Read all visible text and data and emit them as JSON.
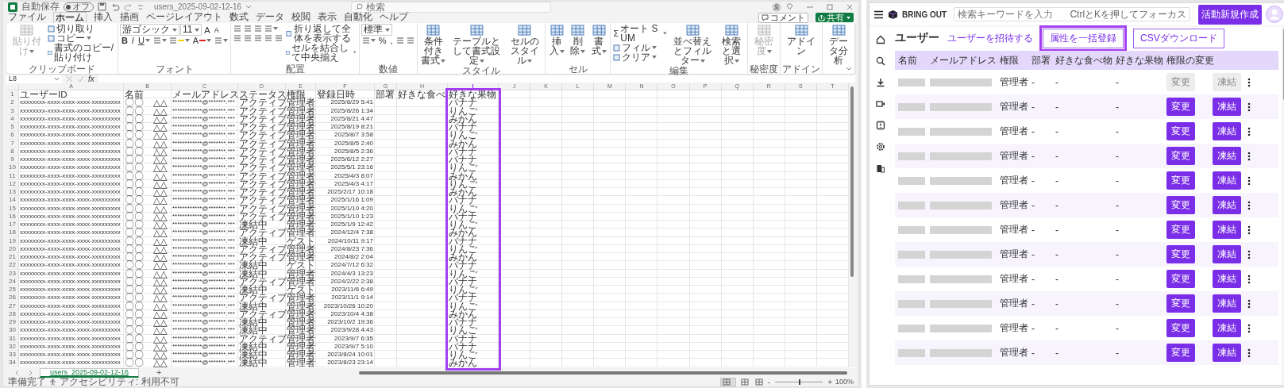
{
  "excel": {
    "title_bar": {
      "autosave_label": "自動保存",
      "autosave_toggle": {
        "label": "オフ",
        "on": false
      },
      "file_name": "users_2025-09-02-12-16",
      "search_placeholder": "検索"
    },
    "menu_tabs": [
      {
        "label": "ファイル",
        "selected": false
      },
      {
        "label": "ホーム",
        "selected": true
      },
      {
        "label": "挿入",
        "selected": false
      },
      {
        "label": "描画",
        "selected": false
      },
      {
        "label": "ページレイアウト",
        "selected": false
      },
      {
        "label": "数式",
        "selected": false
      },
      {
        "label": "データ",
        "selected": false
      },
      {
        "label": "校閲",
        "selected": false
      },
      {
        "label": "表示",
        "selected": false
      },
      {
        "label": "自動化",
        "selected": false
      },
      {
        "label": "ヘルプ",
        "selected": false
      }
    ],
    "comment_button": "コメント",
    "share_button": "共有",
    "ribbon": {
      "groups": [
        {
          "label": "クリップボード",
          "parts": [
            {
              "kind": "big",
              "label": "貼り付け",
              "disabled": true,
              "caret": true
            },
            {
              "kind": "stack",
              "lines": [
                {
                  "items": [
                    {
                      "kind": "small",
                      "label": "切り取り",
                      "caret": false
                    }
                  ]
                },
                {
                  "items": [
                    {
                      "kind": "small",
                      "label": "コピー",
                      "caret": true
                    }
                  ]
                },
                {
                  "items": [
                    {
                      "kind": "small",
                      "label": "書式のコピー/貼り付け",
                      "caret": false
                    }
                  ]
                }
              ]
            }
          ]
        },
        {
          "label": "フォント",
          "parts": [
            {
              "kind": "stack",
              "lines": [
                {
                  "items": [
                    {
                      "kind": "select",
                      "value": "游ゴシック"
                    },
                    {
                      "kind": "select",
                      "value": "11"
                    },
                    {
                      "kind": "glyph",
                      "text": "A",
                      "caret": false
                    },
                    {
                      "kind": "glyph",
                      "text": "A",
                      "caret": false
                    }
                  ]
                },
                {
                  "items": [
                    {
                      "kind": "glyph",
                      "text": "B",
                      "caret": false
                    },
                    {
                      "kind": "glyph",
                      "text": "I",
                      "caret": false
                    },
                    {
                      "kind": "glyph",
                      "text": "U",
                      "caret": true
                    },
                    {
                      "kind": "icon",
                      "caret": true
                    },
                    {
                      "kind": "icon",
                      "color": "#f2d600",
                      "caret": true
                    },
                    {
                      "kind": "glyph",
                      "text": "A",
                      "color": "#e02020",
                      "caret": true
                    },
                    {
                      "kind": "icon",
                      "caret": true
                    }
                  ]
                }
              ]
            }
          ]
        },
        {
          "label": "配置",
          "parts": [
            {
              "kind": "stack",
              "lines": [
                {
                  "items": [
                    {
                      "kind": "icon",
                      "caret": false
                    },
                    {
                      "kind": "icon",
                      "caret": false
                    },
                    {
                      "kind": "icon",
                      "caret": false
                    },
                    {
                      "kind": "icon",
                      "caret": true
                    }
                  ]
                },
                {
                  "items": [
                    {
                      "kind": "icon",
                      "caret": false
                    },
                    {
                      "kind": "icon",
                      "caret": false
                    },
                    {
                      "kind": "icon",
                      "caret": false
                    },
                    {
                      "kind": "icon",
                      "caret": false
                    },
                    {
                      "kind": "icon",
                      "caret": false
                    }
                  ]
                }
              ]
            },
            {
              "kind": "stack",
              "lines": [
                {
                  "items": [
                    {
                      "kind": "small",
                      "label": "折り返して全体を表示する",
                      "caret": false
                    }
                  ]
                },
                {
                  "items": [
                    {
                      "kind": "small",
                      "label": "セルを結合して中央揃え",
                      "caret": true
                    }
                  ]
                }
              ]
            }
          ]
        },
        {
          "label": "数値",
          "parts": [
            {
              "kind": "stack",
              "lines": [
                {
                  "items": [
                    {
                      "kind": "select",
                      "value": "標準"
                    }
                  ]
                },
                {
                  "items": [
                    {
                      "kind": "icon",
                      "caret": true
                    },
                    {
                      "kind": "glyph",
                      "text": "%",
                      "caret": false
                    },
                    {
                      "kind": "glyph",
                      "text": ",",
                      "caret": false
                    },
                    {
                      "kind": "icon",
                      "caret": false
                    },
                    {
                      "kind": "icon",
                      "caret": false
                    }
                  ]
                }
              ]
            }
          ]
        },
        {
          "label": "スタイル",
          "parts": [
            {
              "kind": "big",
              "label": "条件付き書式",
              "disabled": false,
              "caret": true
            },
            {
              "kind": "big",
              "label": "テーブルとして書式設定",
              "disabled": false,
              "caret": true
            },
            {
              "kind": "big",
              "label": "セルのスタイル",
              "disabled": false,
              "caret": true
            }
          ]
        },
        {
          "label": "セル",
          "parts": [
            {
              "kind": "big",
              "label": "挿入",
              "disabled": false,
              "caret": true
            },
            {
              "kind": "big",
              "label": "削除",
              "disabled": false,
              "caret": true
            },
            {
              "kind": "big",
              "label": "書式",
              "disabled": false,
              "caret": true
            }
          ]
        },
        {
          "label": "編集",
          "parts": [
            {
              "kind": "stack",
              "lines": [
                {
                  "items": [
                    {
                      "kind": "small",
                      "glyph": "Σ",
                      "label": "オート SUM",
                      "caret": true
                    }
                  ]
                },
                {
                  "items": [
                    {
                      "kind": "small",
                      "label": "フィル",
                      "caret": true
                    }
                  ]
                },
                {
                  "items": [
                    {
                      "kind": "small",
                      "label": "クリア",
                      "caret": true
                    }
                  ]
                }
              ]
            },
            {
              "kind": "big",
              "label": "並べ替えとフィルター",
              "disabled": false,
              "caret": true
            },
            {
              "kind": "big",
              "label": "検索と選択",
              "disabled": false,
              "caret": true
            }
          ]
        },
        {
          "label": "秘密度",
          "parts": [
            {
              "kind": "big",
              "label": "秘密度",
              "disabled": true,
              "caret": true
            }
          ]
        },
        {
          "label": "アドイン",
          "parts": [
            {
              "kind": "big",
              "label": "アドイン",
              "disabled": false,
              "caret": false
            }
          ]
        },
        {
          "parts": [
            {
              "kind": "big",
              "label": "データ分析",
              "disabled": false,
              "caret": false
            }
          ]
        }
      ]
    },
    "formula_bar": {
      "name_box": "L8",
      "fx": "fx"
    },
    "columns": [
      {
        "letter": "A",
        "highlighted": false
      },
      {
        "letter": "B",
        "highlighted": false
      },
      {
        "letter": "C",
        "highlighted": false
      },
      {
        "letter": "D",
        "highlighted": false
      },
      {
        "letter": "E",
        "highlighted": false
      },
      {
        "letter": "F",
        "highlighted": false
      },
      {
        "letter": "G",
        "highlighted": false
      },
      {
        "letter": "H",
        "highlighted": false
      },
      {
        "letter": "I",
        "highlighted": true
      },
      {
        "letter": "J",
        "highlighted": false
      },
      {
        "letter": "K",
        "highlighted": false
      },
      {
        "letter": "L",
        "highlighted": false
      },
      {
        "letter": "M",
        "highlighted": false
      },
      {
        "letter": "N",
        "highlighted": false
      },
      {
        "letter": "O",
        "highlighted": false
      },
      {
        "letter": "P",
        "highlighted": false
      },
      {
        "letter": "Q",
        "highlighted": false
      },
      {
        "letter": "R",
        "highlighted": false
      },
      {
        "letter": "S",
        "highlighted": false
      },
      {
        "letter": "T",
        "highlighted": false
      }
    ],
    "header_row": {
      "n": "1",
      "cells": [
        "ユーザーID",
        "名前",
        "メールアドレス",
        "ステータス",
        "権限",
        "登録日時",
        "部署",
        "好きな食べ",
        "好きな果物"
      ]
    },
    "rows": [
      {
        "n": "2",
        "id": "xxxxxxxx-xxxx-xxxx-xxxx-xxxxxxxxx",
        "name": "〇〇　△△",
        "email": "************@*******.***",
        "status": "アクティブ",
        "role": "管理者",
        "registered": "2025/8/29 5:41",
        "fruit": "バナナ"
      },
      {
        "n": "3",
        "id": "xxxxxxxx-xxxx-xxxx-xxxx-xxxxxxxxx",
        "name": "〇〇　△△",
        "email": "************@*******.***",
        "status": "アクティブ",
        "role": "管理者",
        "registered": "2025/8/26 1:34",
        "fruit": "りんご"
      },
      {
        "n": "4",
        "id": "xxxxxxxx-xxxx-xxxx-xxxx-xxxxxxxxx",
        "name": "〇〇　△△",
        "email": "************@*******.***",
        "status": "アクティブ",
        "role": "管理者",
        "registered": "2025/8/21 4:47",
        "fruit": "みかん"
      },
      {
        "n": "5",
        "id": "xxxxxxxx-xxxx-xxxx-xxxx-xxxxxxxxx",
        "name": "〇〇　△△",
        "email": "************@*******.***",
        "status": "アクティブ",
        "role": "管理者",
        "registered": "2025/8/19 8:21",
        "fruit": "バナナ"
      },
      {
        "n": "6",
        "id": "xxxxxxxx-xxxx-xxxx-xxxx-xxxxxxxxx",
        "name": "〇〇　△△",
        "email": "************@*******.***",
        "status": "アクティブ",
        "role": "管理者",
        "registered": "2025/8/7 3:58",
        "fruit": "りんご"
      },
      {
        "n": "7",
        "id": "xxxxxxxx-xxxx-xxxx-xxxx-xxxxxxxxx",
        "name": "〇〇　△△",
        "email": "************@*******.***",
        "status": "アクティブ",
        "role": "管理者",
        "registered": "2025/8/5 2:40",
        "fruit": "みかん"
      },
      {
        "n": "8",
        "id": "xxxxxxxx-xxxx-xxxx-xxxx-xxxxxxxxx",
        "name": "〇〇　△△",
        "email": "************@*******.***",
        "status": "アクティブ",
        "role": "管理者",
        "registered": "2025/8/5 2:36",
        "fruit": "バナナ"
      },
      {
        "n": "9",
        "id": "xxxxxxxx-xxxx-xxxx-xxxx-xxxxxxxxx",
        "name": "〇〇　△△",
        "email": "************@*******.***",
        "status": "アクティブ",
        "role": "管理者",
        "registered": "2025/6/12 2:27",
        "fruit": "バナナ"
      },
      {
        "n": "10",
        "id": "xxxxxxxx-xxxx-xxxx-xxxx-xxxxxxxxx",
        "name": "〇〇　△△",
        "email": "************@*******.***",
        "status": "アクティブ",
        "role": "管理者",
        "registered": "2025/5/1 23:16",
        "fruit": "りんご"
      },
      {
        "n": "11",
        "id": "xxxxxxxx-xxxx-xxxx-xxxx-xxxxxxxxx",
        "name": "〇〇　△△",
        "email": "************@*******.***",
        "status": "アクティブ",
        "role": "管理者",
        "registered": "2025/4/3 8:07",
        "fruit": "みかん"
      },
      {
        "n": "12",
        "id": "xxxxxxxx-xxxx-xxxx-xxxx-xxxxxxxxx",
        "name": "〇〇　△△",
        "email": "************@*******.***",
        "status": "アクティブ",
        "role": "管理者",
        "registered": "2025/4/3 4:17",
        "fruit": "りんご"
      },
      {
        "n": "13",
        "id": "xxxxxxxx-xxxx-xxxx-xxxx-xxxxxxxxx",
        "name": "〇〇　△△",
        "email": "************@*******.***",
        "status": "アクティブ",
        "role": "管理者",
        "registered": "2025/2/17 10:18",
        "fruit": "みかん"
      },
      {
        "n": "14",
        "id": "xxxxxxxx-xxxx-xxxx-xxxx-xxxxxxxxx",
        "name": "〇〇　△△",
        "email": "************@*******.***",
        "status": "アクティブ",
        "role": "管理者",
        "registered": "2025/1/16 1:09",
        "fruit": "バナナ"
      },
      {
        "n": "15",
        "id": "xxxxxxxx-xxxx-xxxx-xxxx-xxxxxxxxx",
        "name": "〇〇　△△",
        "email": "************@*******.***",
        "status": "アクティブ",
        "role": "管理者",
        "registered": "2025/1/10 4:20",
        "fruit": "りんご"
      },
      {
        "n": "16",
        "id": "xxxxxxxx-xxxx-xxxx-xxxx-xxxxxxxxx",
        "name": "〇〇　△△",
        "email": "************@*******.***",
        "status": "アクティブ",
        "role": "管理者",
        "registered": "2025/1/10 1:23",
        "fruit": "バナナ"
      },
      {
        "n": "17",
        "id": "xxxxxxxx-xxxx-xxxx-xxxx-xxxxxxxxx",
        "name": "〇〇　△△",
        "email": "************@*******.***",
        "status": "凍結中",
        "role": "管理者",
        "registered": "2025/1/9 12:42",
        "fruit": "りんご"
      },
      {
        "n": "18",
        "id": "xxxxxxxx-xxxx-xxxx-xxxx-xxxxxxxxx",
        "name": "〇〇　△△",
        "email": "************@*******.***",
        "status": "アクティブ",
        "role": "管理者",
        "registered": "2024/12/4 7:38",
        "fruit": "みかん"
      },
      {
        "n": "19",
        "id": "xxxxxxxx-xxxx-xxxx-xxxx-xxxxxxxxx",
        "name": "〇〇　△△",
        "email": "************@*******.***",
        "status": "凍結中",
        "role": "ゲスト",
        "registered": "2024/10/11 9:17",
        "fruit": "バナナ"
      },
      {
        "n": "20",
        "id": "xxxxxxxx-xxxx-xxxx-xxxx-xxxxxxxxx",
        "name": "〇〇　△△",
        "email": "************@*******.***",
        "status": "アクティブ",
        "role": "管理者",
        "registered": "2024/8/23 7:36",
        "fruit": "りんご"
      },
      {
        "n": "21",
        "id": "xxxxxxxx-xxxx-xxxx-xxxx-xxxxxxxxx",
        "name": "〇〇　△△",
        "email": "************@*******.***",
        "status": "アクティブ",
        "role": "管理者",
        "registered": "2024/8/2 2:04",
        "fruit": "みかん"
      },
      {
        "n": "22",
        "id": "xxxxxxxx-xxxx-xxxx-xxxx-xxxxxxxxx",
        "name": "〇〇　△△",
        "email": "************@*******.***",
        "status": "凍結中",
        "role": "ゲスト",
        "registered": "2024/7/12 6:32",
        "fruit": "バナナ"
      },
      {
        "n": "23",
        "id": "xxxxxxxx-xxxx-xxxx-xxxx-xxxxxxxxx",
        "name": "〇〇　△△",
        "email": "************@*******.***",
        "status": "凍結中",
        "role": "管理者",
        "registered": "2024/4/3 13:23",
        "fruit": "りんご"
      },
      {
        "n": "24",
        "id": "xxxxxxxx-xxxx-xxxx-xxxx-xxxxxxxxx",
        "name": "〇〇　△△",
        "email": "************@*******.***",
        "status": "アクティブ",
        "role": "管理者",
        "registered": "2024/2/22 2:38",
        "fruit": "バナナ"
      },
      {
        "n": "25",
        "id": "xxxxxxxx-xxxx-xxxx-xxxx-xxxxxxxxx",
        "name": "〇〇　△△",
        "email": "************@*******.***",
        "status": "凍結中",
        "role": "ゲスト",
        "registered": "2023/11/6 6:49",
        "fruit": "りんご"
      },
      {
        "n": "26",
        "id": "xxxxxxxx-xxxx-xxxx-xxxx-xxxxxxxxx",
        "name": "〇〇　△△",
        "email": "************@*******.***",
        "status": "アクティブ",
        "role": "管理者",
        "registered": "2023/11/1 9:14",
        "fruit": "バナナ"
      },
      {
        "n": "27",
        "id": "xxxxxxxx-xxxx-xxxx-xxxx-xxxxxxxxx",
        "name": "〇〇　△△",
        "email": "************@*******.***",
        "status": "凍結中",
        "role": "管理者",
        "registered": "2023/10/26 10:20",
        "fruit": "りんご"
      },
      {
        "n": "28",
        "id": "xxxxxxxx-xxxx-xxxx-xxxx-xxxxxxxxx",
        "name": "〇〇　△△",
        "email": "************@*******.***",
        "status": "アクティブ",
        "role": "管理者",
        "registered": "2023/10/4 4:38",
        "fruit": "みかん"
      },
      {
        "n": "29",
        "id": "xxxxxxxx-xxxx-xxxx-xxxx-xxxxxxxxx",
        "name": "〇〇　△△",
        "email": "************@*******.***",
        "status": "凍結中",
        "role": "管理者",
        "registered": "2023/10/2 19:36",
        "fruit": "バナナ"
      },
      {
        "n": "30",
        "id": "xxxxxxxx-xxxx-xxxx-xxxx-xxxxxxxxx",
        "name": "〇〇　△△",
        "email": "************@*******.***",
        "status": "凍結中",
        "role": "管理者",
        "registered": "2023/9/28 4:43",
        "fruit": "りんご"
      },
      {
        "n": "31",
        "id": "xxxxxxxx-xxxx-xxxx-xxxx-xxxxxxxxx",
        "name": "〇〇　△△",
        "email": "************@*******.***",
        "status": "アクティブ",
        "role": "管理者",
        "registered": "2023/9/7 6:35",
        "fruit": "バナナ"
      },
      {
        "n": "32",
        "id": "xxxxxxxx-xxxx-xxxx-xxxx-xxxxxxxxx",
        "name": "〇〇　△△",
        "email": "************@*******.***",
        "status": "凍結中",
        "role": "管理者",
        "registered": "2023/9/7 5:10",
        "fruit": "バナナ"
      },
      {
        "n": "33",
        "id": "xxxxxxxx-xxxx-xxxx-xxxx-xxxxxxxxx",
        "name": "〇〇　△△",
        "email": "************@*******.***",
        "status": "凍結中",
        "role": "管理者",
        "registered": "2023/8/24 10:01",
        "fruit": "りんご"
      },
      {
        "n": "34",
        "id": "xxxxxxxx-xxxx-xxxx-xxxx-xxxxxxxxx",
        "name": "〇〇　△△",
        "email": "************@*******.***",
        "status": "凍結中",
        "role": "管理者",
        "registered": "2023/8/23 23:14",
        "fruit": "みかん"
      }
    ],
    "sheet_tabs": [
      {
        "label": "users_2025-09-02-12-16",
        "selected": true
      }
    ],
    "add_sheet": "+",
    "status_bar": {
      "ready": "準備完了",
      "accessibility": "アクセシビリティ: 利用不可",
      "view_buttons": [
        {
          "selected": true
        },
        {
          "selected": false
        },
        {
          "selected": false
        }
      ],
      "zoom_out": "-",
      "zoom_in": "+",
      "zoom_slider": {
        "level": 0.5
      },
      "zoom": "100%"
    }
  },
  "web": {
    "logo": "BRING OUT",
    "search_placeholder": "検索キーワードを入力",
    "search_hint": "CtrlとKを押してフォーカス",
    "create_button": "活動新規作成",
    "page_title": "ユーザー",
    "invite_link": "ユーザーを招待する",
    "actions": [
      {
        "label": "属性を一括登録",
        "highlighted": true
      },
      {
        "label": "CSVダウンロード",
        "highlighted": false
      }
    ],
    "columns": [
      "名前",
      "メールアドレス",
      "権限",
      "部署",
      "好きな食べ物",
      "好きな果物",
      "権限の変更"
    ],
    "rows": [
      {
        "role": "管理者",
        "department": "-",
        "food": "-",
        "fruit": "-",
        "change": "変更",
        "freeze": "凍結",
        "disabled": true
      },
      {
        "role": "管理者",
        "department": "-",
        "food": "-",
        "fruit": "-",
        "change": "変更",
        "freeze": "凍結",
        "disabled": false
      },
      {
        "role": "管理者",
        "department": "-",
        "food": "-",
        "fruit": "-",
        "change": "変更",
        "freeze": "凍結",
        "disabled": false
      },
      {
        "role": "管理者",
        "department": "-",
        "food": "-",
        "fruit": "-",
        "change": "変更",
        "freeze": "凍結",
        "disabled": false
      },
      {
        "role": "管理者",
        "department": "-",
        "food": "-",
        "fruit": "-",
        "change": "変更",
        "freeze": "凍結",
        "disabled": false
      },
      {
        "role": "管理者",
        "department": "-",
        "food": "-",
        "fruit": "-",
        "change": "変更",
        "freeze": "凍結",
        "disabled": false
      },
      {
        "role": "管理者",
        "department": "-",
        "food": "-",
        "fruit": "-",
        "change": "変更",
        "freeze": "凍結",
        "disabled": false
      },
      {
        "role": "管理者",
        "department": "-",
        "food": "-",
        "fruit": "-",
        "change": "変更",
        "freeze": "凍結",
        "disabled": false
      },
      {
        "role": "管理者",
        "department": "-",
        "food": "-",
        "fruit": "-",
        "change": "変更",
        "freeze": "凍結",
        "disabled": false
      },
      {
        "role": "管理者",
        "department": "-",
        "food": "-",
        "fruit": "-",
        "change": "変更",
        "freeze": "凍結",
        "disabled": false
      },
      {
        "role": "管理者",
        "department": "-",
        "food": "-",
        "fruit": "-",
        "change": "変更",
        "freeze": "凍結",
        "disabled": false
      },
      {
        "role": "管理者",
        "department": "-",
        "food": "-",
        "fruit": "-",
        "change": "変更",
        "freeze": "凍結",
        "disabled": false
      }
    ]
  }
}
